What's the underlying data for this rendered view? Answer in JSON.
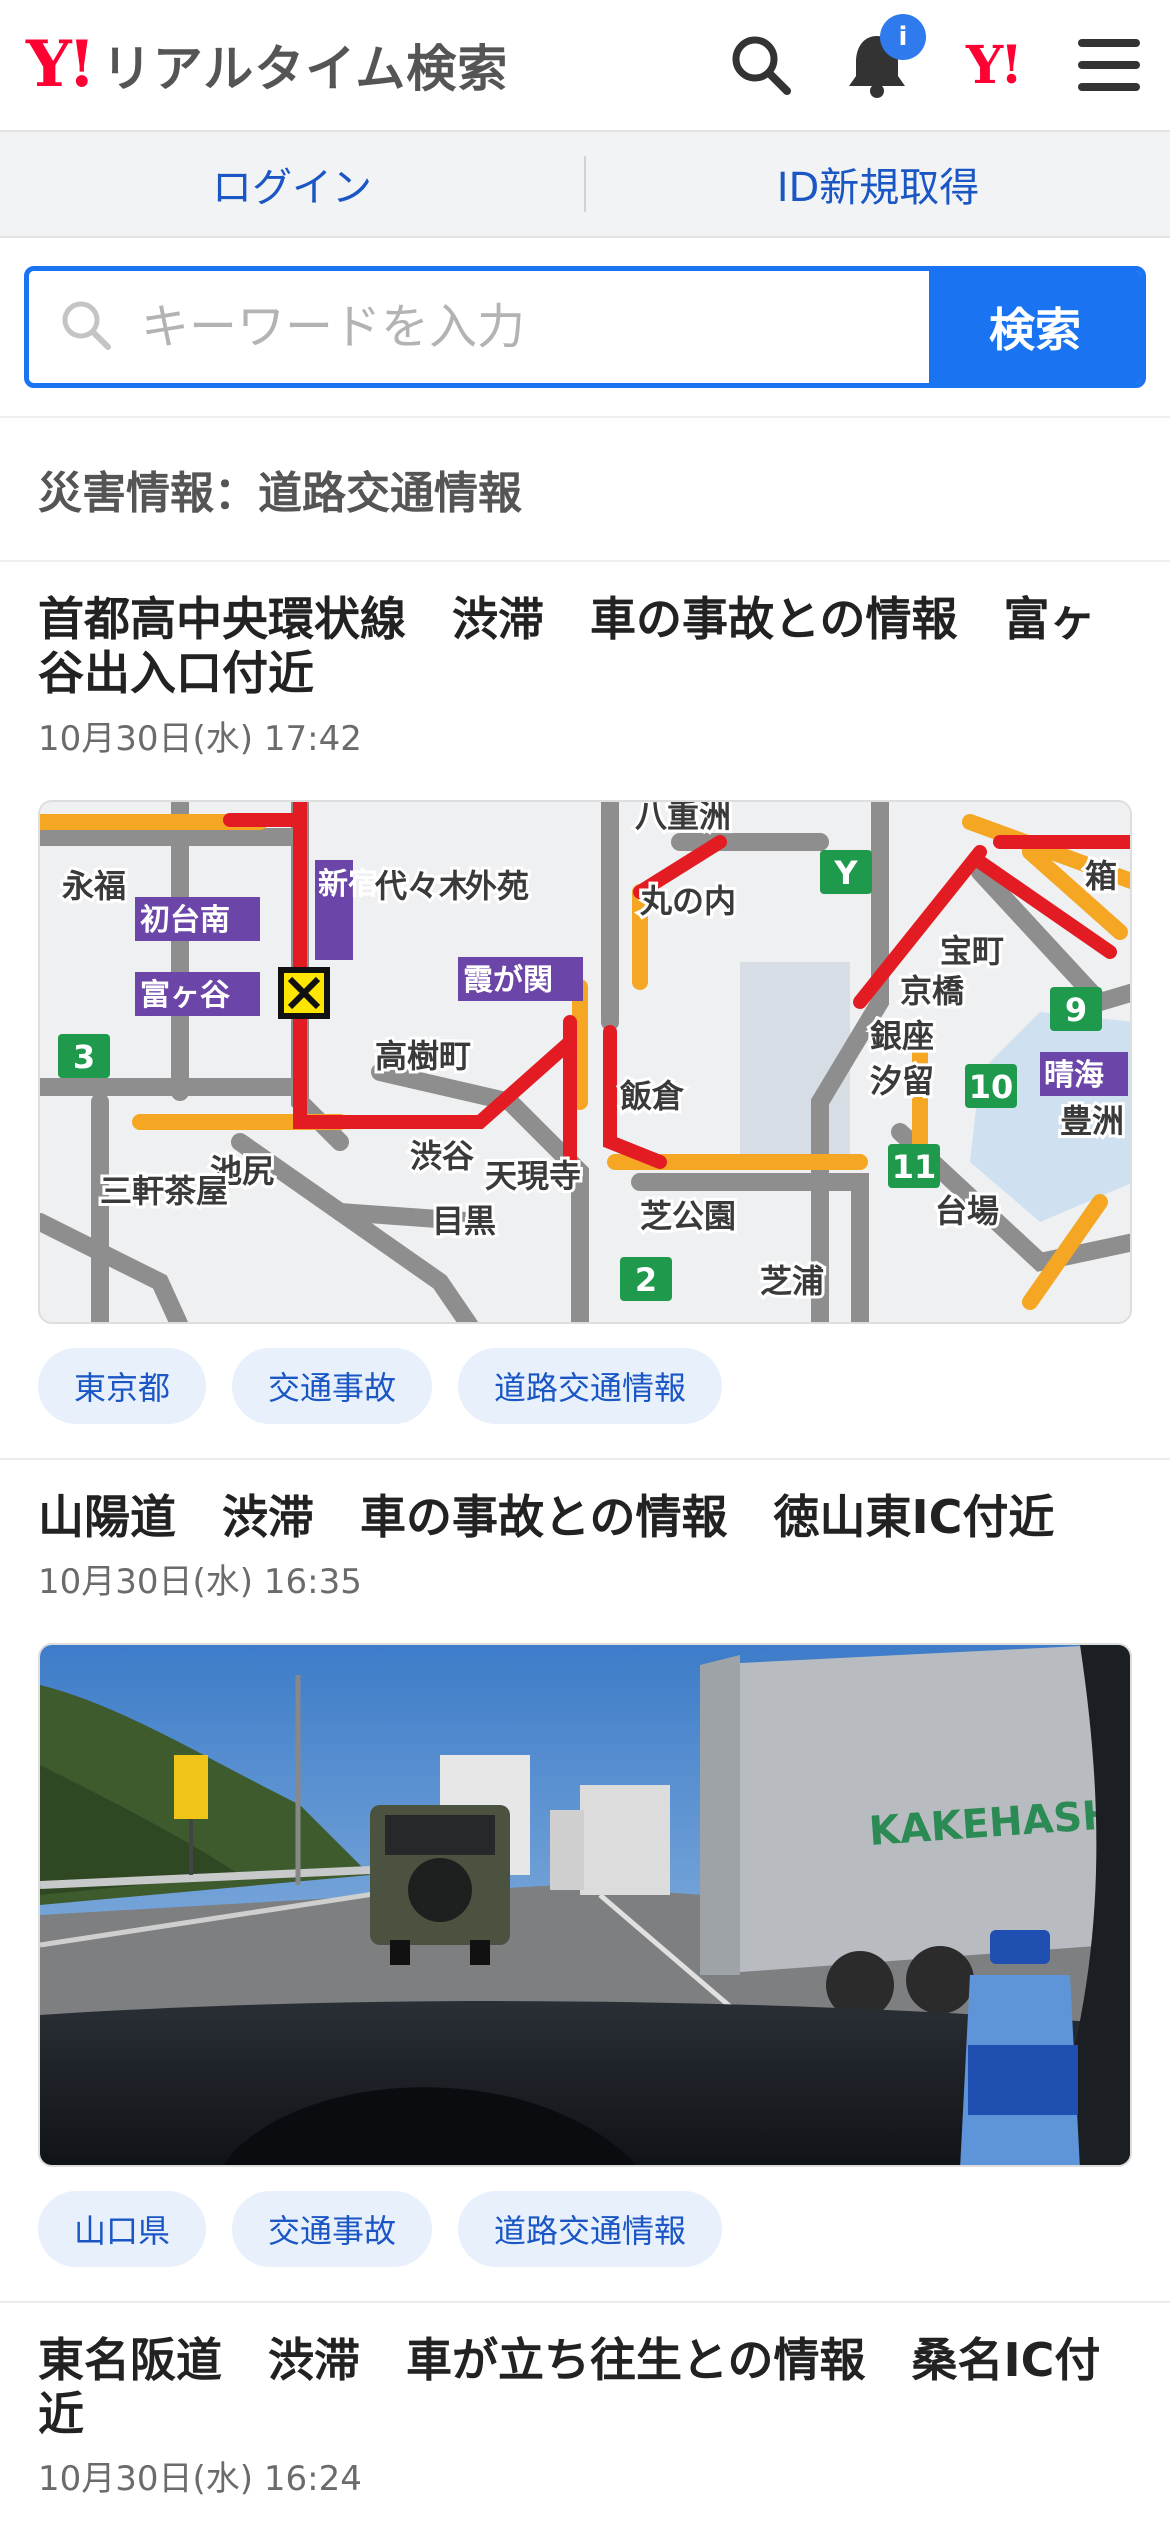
{
  "header": {
    "logo_mark": "Y!",
    "logo_text": "リアルタイム検索",
    "notification_badge": "i",
    "y_mini": "Y!"
  },
  "login_bar": {
    "login": "ログイン",
    "register": "ID新規取得"
  },
  "search": {
    "placeholder": "キーワードを入力",
    "button": "検索"
  },
  "section": {
    "title": "災害情報：道路交通情報"
  },
  "articles": [
    {
      "title": "首都高中央環状線　渋滞　車の事故との情報　富ヶ谷出入口付近",
      "time": "10月30日(水) 17:42",
      "tags": [
        "東京都",
        "交通事故",
        "道路交通情報"
      ],
      "map_labels": {
        "l1": "永福",
        "l2": "初台南",
        "l3": "新宿",
        "l4": "代々木",
        "l5": "外苑",
        "l6": "富ヶ谷",
        "l7": "霞が関",
        "l8": "高樹町",
        "l9": "渋谷",
        "l10": "天現寺",
        "l11": "目黒",
        "l12": "池尻",
        "l13": "三軒茶屋",
        "l14": "八重洲",
        "l15": "丸の内",
        "l16": "飯倉",
        "l17": "宝町",
        "l18": "京橋",
        "l19": "銀座",
        "l20": "汐留",
        "l21": "晴海",
        "l22": "豊洲",
        "l23": "芝公園",
        "l24": "芝浦",
        "l25": "台場",
        "l26": "箱",
        "r3": "3",
        "r2": "2",
        "r9": "9",
        "r10": "10",
        "r11": "11",
        "ry": "Y"
      }
    },
    {
      "title": "山陽道　渋滞　車の事故との情報　徳山東IC付近",
      "time": "10月30日(水) 16:35",
      "tags": [
        "山口県",
        "交通事故",
        "道路交通情報"
      ],
      "photo_text": "KAKEHASHI"
    },
    {
      "title": "東名阪道　渋滞　車が立ち往生との情報　桑名IC付近",
      "time": "10月30日(水) 16:24"
    }
  ]
}
